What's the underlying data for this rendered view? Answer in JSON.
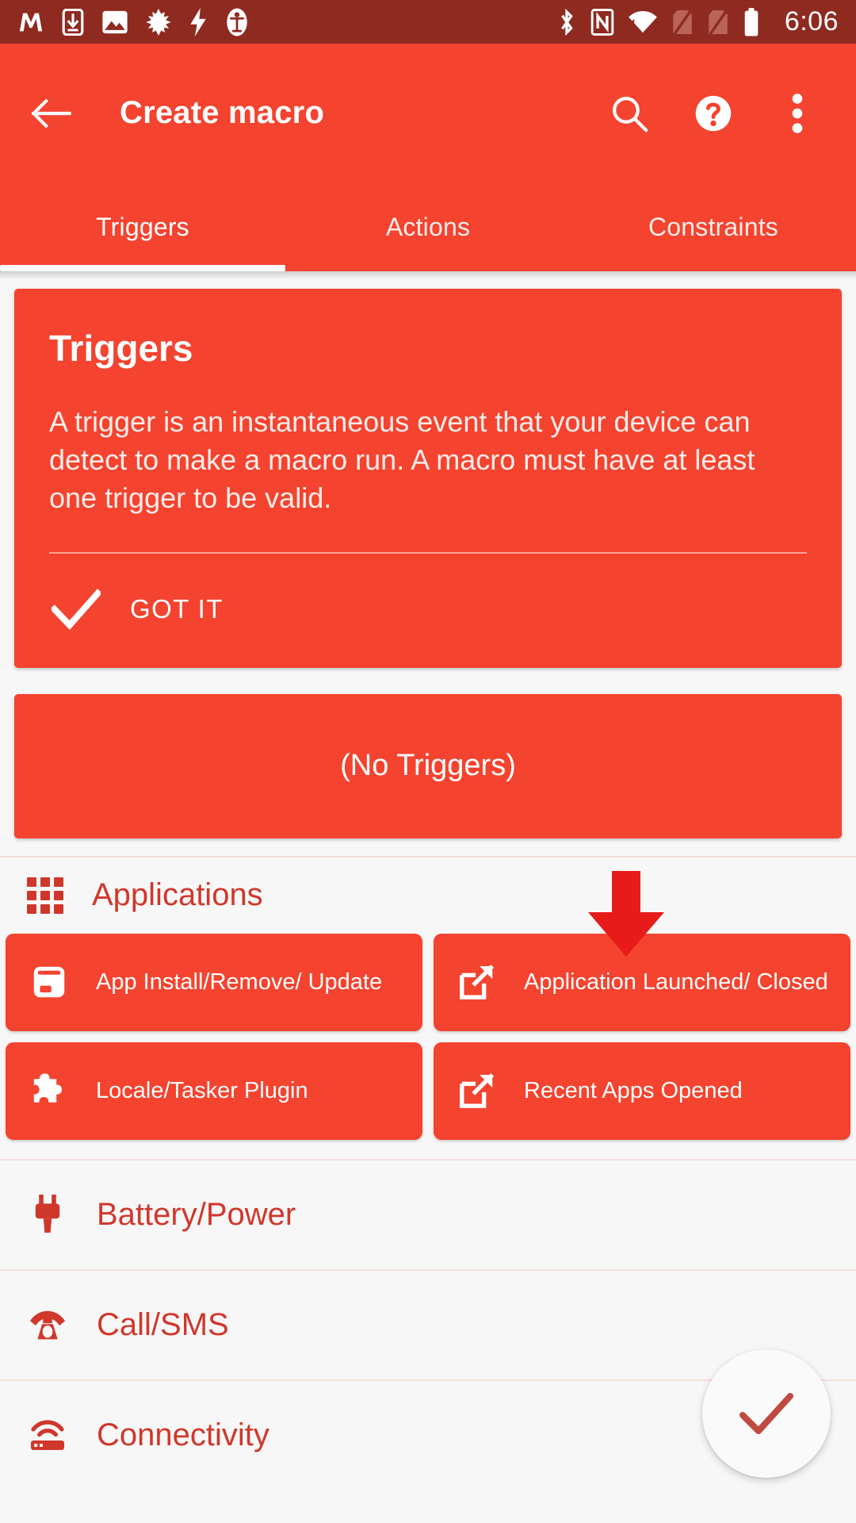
{
  "status_bar": {
    "time": "6:06",
    "left_icons": [
      "mastodon-icon",
      "download-to-device-icon",
      "image-icon",
      "leaf-icon",
      "flash-icon",
      "accessibility-icon"
    ],
    "right_icons": [
      "bluetooth-icon",
      "nfc-icon",
      "wifi-icon",
      "sim-1-off-icon",
      "sim-2-off-icon",
      "battery-icon"
    ],
    "background_color": "#8E2A20"
  },
  "app_bar": {
    "title": "Create macro",
    "back_icon": "back-arrow-icon",
    "actions": [
      {
        "icon": "search-icon",
        "name": "search-button"
      },
      {
        "icon": "help-circle-icon",
        "name": "help-button"
      },
      {
        "icon": "overflow-menu-icon",
        "name": "overflow-menu-button"
      }
    ],
    "background_color": "#F4432F"
  },
  "tabs": {
    "items": [
      {
        "label": "Triggers",
        "active": true
      },
      {
        "label": "Actions",
        "active": false
      },
      {
        "label": "Constraints",
        "active": false
      }
    ],
    "indicator_color": "#FFFFFF"
  },
  "info_card": {
    "title": "Triggers",
    "body": "A trigger is an instantaneous event that your device can detect to make a macro run. A macro must have at least one trigger to be valid.",
    "dismiss_label": "GOT IT",
    "dismiss_icon": "check-icon",
    "background_color": "#F4432F"
  },
  "no_triggers_button": {
    "label": "(No Triggers)"
  },
  "annotation": {
    "arrow_icon": "down-arrow-annotation",
    "color": "#E81B1B"
  },
  "applications_section": {
    "title": "Applications",
    "icon": "apps-grid-icon",
    "chips": [
      [
        {
          "label": "App Install/Remove/ Update",
          "icon": "package-box-icon",
          "name": "trigger-app-install-remove-update"
        },
        {
          "label": "Application Launched/ Closed",
          "icon": "open-in-new-icon",
          "name": "trigger-application-launched-closed"
        }
      ],
      [
        {
          "label": "Locale/Tasker Plugin",
          "icon": "puzzle-piece-icon",
          "name": "trigger-locale-tasker-plugin"
        },
        {
          "label": "Recent Apps Opened",
          "icon": "open-in-new-icon",
          "name": "trigger-recent-apps-opened"
        }
      ]
    ]
  },
  "categories": [
    {
      "label": "Battery/Power",
      "icon": "power-plug-icon",
      "name": "category-battery-power"
    },
    {
      "label": "Call/SMS",
      "icon": "rotary-phone-icon",
      "name": "category-call-sms"
    },
    {
      "label": "Connectivity",
      "icon": "wifi-router-icon",
      "name": "category-connectivity"
    }
  ],
  "fab": {
    "icon": "check-icon",
    "name": "confirm-fab",
    "color": "#C04A42"
  },
  "theme": {
    "primary": "#F4432F",
    "primary_dark": "#8E2A20",
    "accent_text": "#D0372B",
    "page_background": "#F8F7F7",
    "divider": "#F2DEDC"
  }
}
